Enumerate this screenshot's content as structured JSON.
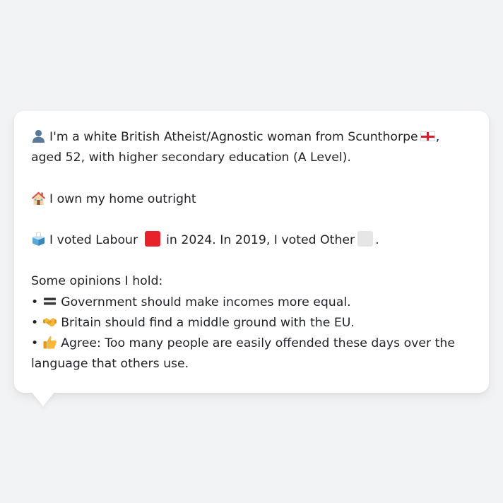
{
  "profile": {
    "identity_text_1": "I'm a white British Atheist/Agnostic woman from Scunthorpe",
    "identity_text_2": ", aged 52, with higher secondary education (A Level).",
    "home_text": "I own my home outright",
    "vote_text_1": "I voted Labour",
    "vote_text_2": "in 2024. In 2019, I voted Other",
    "vote_text_3": ".",
    "opinions_heading": "Some opinions I hold:",
    "opinions": [
      {
        "bullet": "•",
        "icon": "equals-icon",
        "text": "Government should make incomes more equal."
      },
      {
        "bullet": "•",
        "icon": "handshake-icon",
        "text": "Britain should find a middle ground with the EU."
      },
      {
        "bullet": "•",
        "icon": "thumbs-up-icon",
        "text": "Agree: Too many people are easily offended these days over the language that others use."
      }
    ]
  },
  "icons": {
    "identity": "bust-silhouette-icon",
    "home": "house-icon",
    "vote": "ballot-box-icon",
    "flag": "england-flag-icon"
  },
  "colors": {
    "background": "#f2f3f5",
    "card": "#ffffff",
    "text": "#1f2329",
    "labour": "#e8222a",
    "other": "#e6e6e6"
  }
}
